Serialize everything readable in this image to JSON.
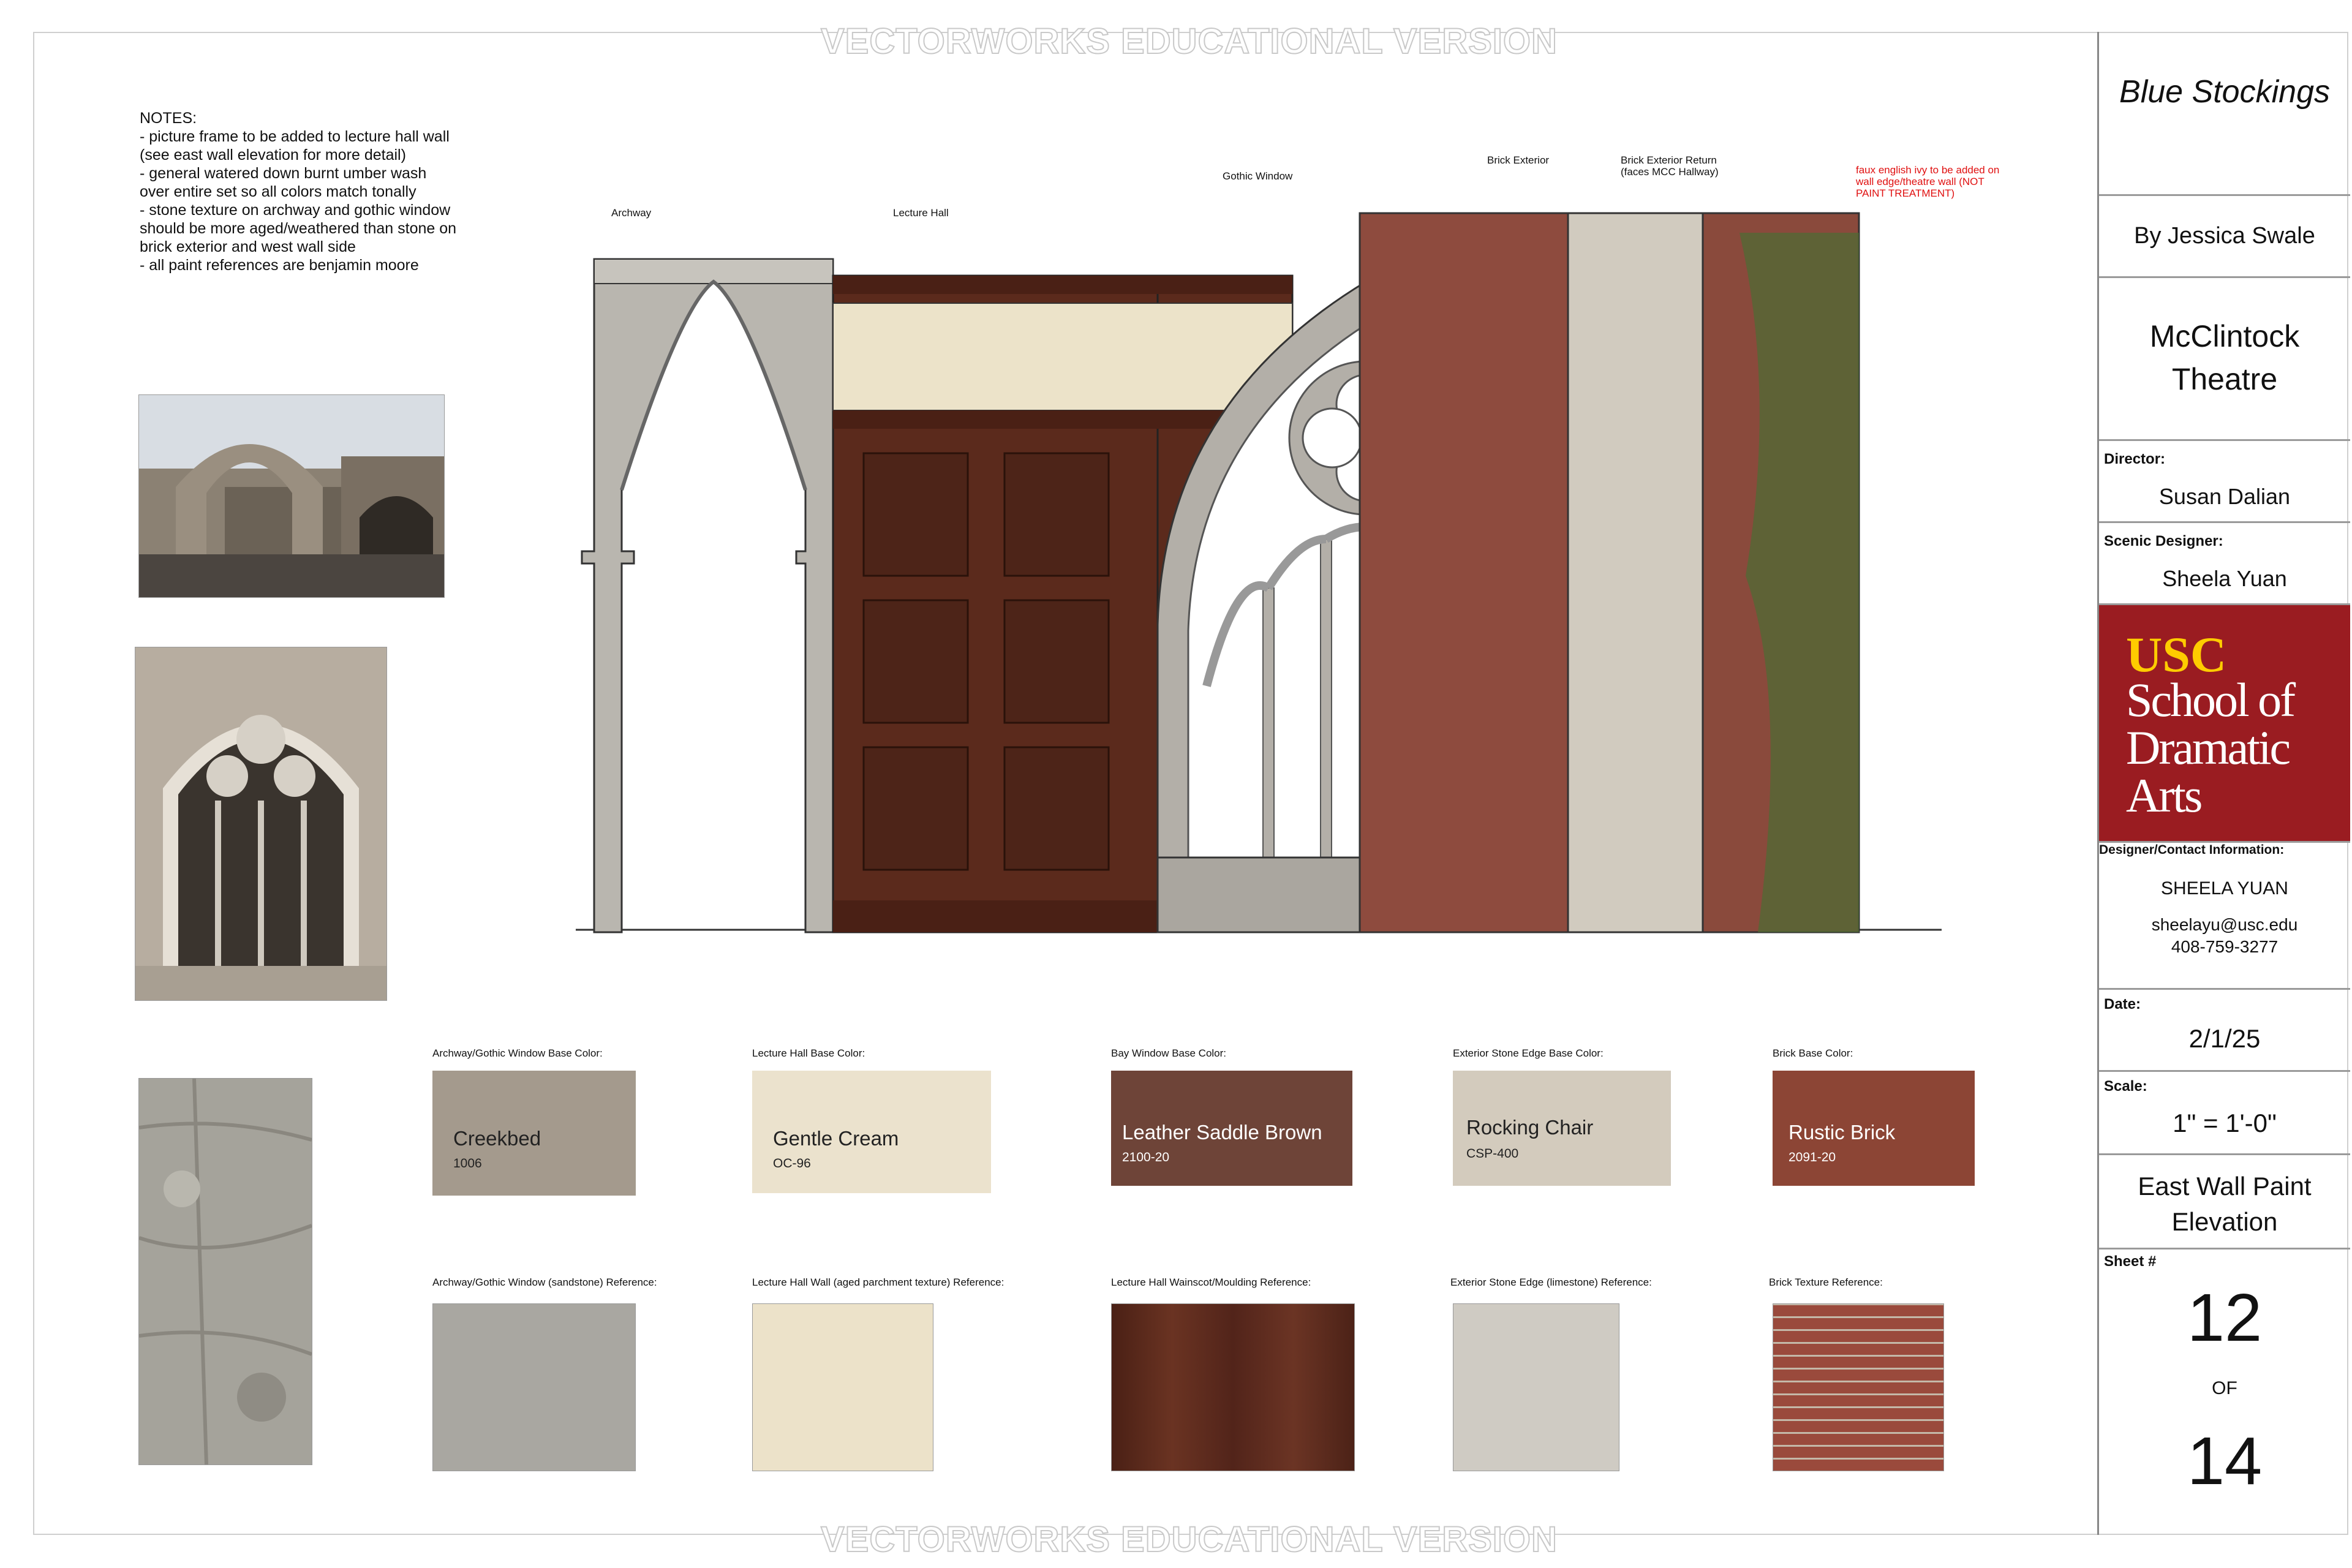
{
  "watermark": "VECTORWORKS EDUCATIONAL VERSION",
  "notes": "NOTES:\n- picture frame to be added to lecture hall wall (see east wall elevation for more detail)\n- general watered down burnt umber wash over entire set so all colors match tonally\n- stone texture on archway and gothic window should be more aged/weathered than stone on brick exterior and west wall side\n- all paint references are benjamin moore",
  "callouts": {
    "archway": "Archway",
    "lecture_hall": "Lecture Hall",
    "gothic_window": "Gothic Window",
    "brick_exterior": "Brick Exterior",
    "brick_return": "Brick Exterior Return\n(faces MCC Hallway)",
    "ivy_note": "faux english ivy to be added on\nwall edge/theatre wall (NOT\nPAINT TREATMENT)"
  },
  "base_colors": [
    {
      "label": "Archway/Gothic Window Base Color:",
      "name": "Creekbed",
      "code": "1006",
      "color": "#a49a8d",
      "text": "dark"
    },
    {
      "label": "Lecture Hall Base Color:",
      "name": "Gentle Cream",
      "code": "OC-96",
      "color": "#ebe2cd",
      "text": "dark"
    },
    {
      "label": "Bay Window Base Color:",
      "name": "Leather Saddle Brown",
      "code": "2100-20",
      "color": "#6e4438",
      "text": "light"
    },
    {
      "label": "Exterior Stone Edge Base Color:",
      "name": "Rocking Chair",
      "code": "CSP-400",
      "color": "#d3cbbd",
      "text": "dark"
    },
    {
      "label": "Brick Base Color:",
      "name": "Rustic Brick",
      "code": "2091-20",
      "color": "#8c4535",
      "text": "light"
    }
  ],
  "references": [
    {
      "label": "Archway/Gothic Window (sandstone) Reference:",
      "color": "#a9a7a1"
    },
    {
      "label": "Lecture Hall Wall (aged parchment texture) Reference:",
      "color": "#ece2c9"
    },
    {
      "label": "Lecture Hall Wainscot/Moulding Reference:",
      "color": "#5a2c1f"
    },
    {
      "label": "Exterior Stone Edge (limestone) Reference:",
      "color": "#cfcbc3"
    },
    {
      "label": "Brick Texture Reference:",
      "color": "#9a4a3c"
    }
  ],
  "title_block": {
    "show": "Blue Stockings",
    "author": "By Jessica Swale",
    "venue": "McClintock Theatre",
    "director_label": "Director:",
    "director": "Susan Dalian",
    "designer_label": "Scenic Designer:",
    "designer": "Sheela Yuan",
    "logo_usc": "USC",
    "logo_school": "School of Dramatic Arts",
    "contact_label": "Designer/Contact Information:",
    "contact_name": "SHEELA YUAN",
    "contact_email": "sheelayu@usc.edu",
    "contact_phone": "408-759-3277",
    "date_label": "Date:",
    "date": "2/1/25",
    "scale_label": "Scale:",
    "scale": "1\" = 1'-0\"",
    "drawing_title": "East Wall Paint Elevation",
    "sheet_label": "Sheet #",
    "sheet_num": "12",
    "sheet_of": "OF",
    "sheet_total": "14"
  },
  "colors": {
    "usc_red": "#9a1c21",
    "usc_gold": "#ffcc00",
    "wood": "#5b2a1c",
    "stone": "#b5b1aa",
    "brick": "#8e4b3e"
  }
}
